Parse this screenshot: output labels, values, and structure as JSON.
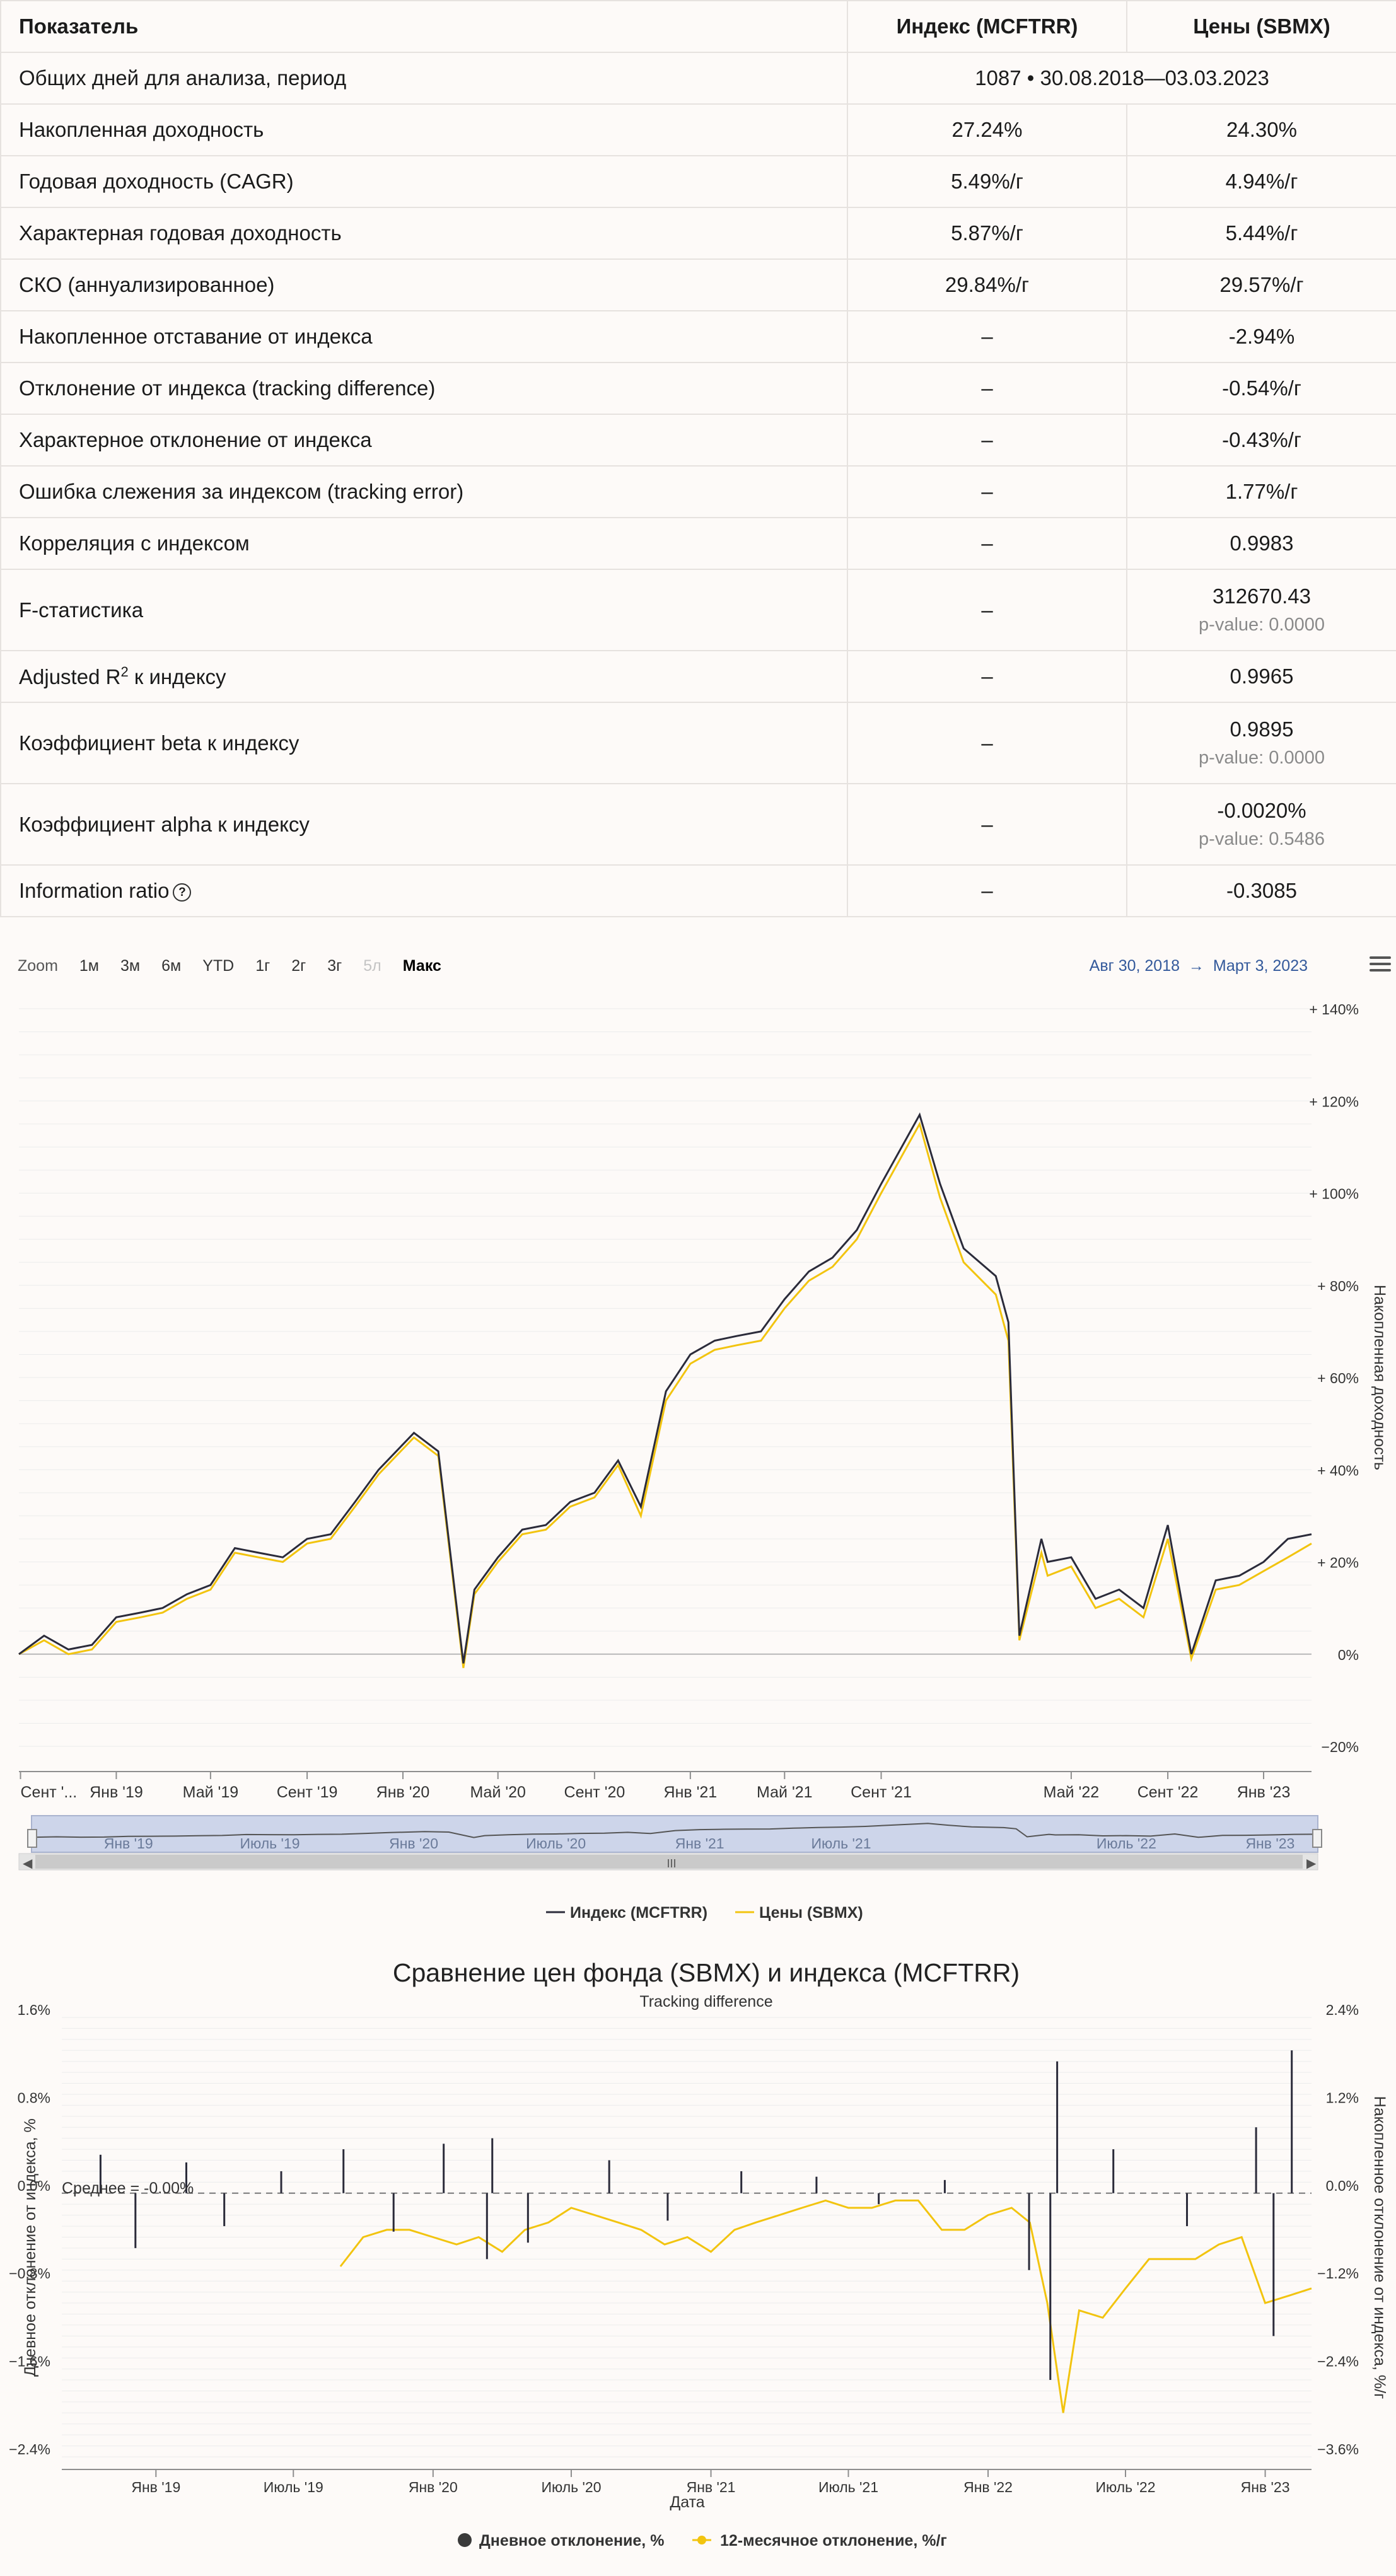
{
  "table": {
    "headers": [
      "Показатель",
      "Индекс (MCFTRR)",
      "Цены (SBMX)"
    ],
    "period_row": {
      "label": "Общих дней для анализа, период",
      "value": "1087 • 30.08.2018—03.03.2023"
    },
    "rows": [
      {
        "label": "Накопленная доходность",
        "index": "27.24%",
        "price": "24.30%"
      },
      {
        "label": "Годовая доходность (CAGR)",
        "index": "5.49%/г",
        "price": "4.94%/г"
      },
      {
        "label": "Характерная годовая доходность",
        "index": "5.87%/г",
        "price": "5.44%/г"
      },
      {
        "label": "СКО (аннуализированное)",
        "index": "29.84%/г",
        "price": "29.57%/г"
      },
      {
        "label": "Накопленное отставание от индекса",
        "index": "–",
        "price": "-2.94%"
      },
      {
        "label": "Отклонение от индекса (tracking difference)",
        "index": "–",
        "price": "-0.54%/г"
      },
      {
        "label": "Характерное отклонение от индекса",
        "index": "–",
        "price": "-0.43%/г"
      },
      {
        "label": "Ошибка слежения за индексом (tracking error)",
        "index": "–",
        "price": "1.77%/г"
      },
      {
        "label": "Корреляция с индексом",
        "index": "–",
        "price": "0.9983"
      }
    ],
    "f_stat": {
      "label": "F-статистика",
      "index": "–",
      "price": "312670.43",
      "pvalue": "p-value: 0.0000"
    },
    "adj_r2": {
      "label_prefix": "Adjusted R",
      "label_sup": "2",
      "label_suffix": " к индексу",
      "index": "–",
      "price": "0.9965"
    },
    "beta": {
      "label": "Коэффициент beta к индексу",
      "index": "–",
      "price": "0.9895",
      "pvalue": "p-value: 0.0000"
    },
    "alpha": {
      "label": "Коэффициент alpha к индексу",
      "index": "–",
      "price": "-0.0020%",
      "pvalue": "p-value: 0.5486"
    },
    "info_ratio": {
      "label": "Information ratio",
      "index": "–",
      "price": "-0.3085",
      "icon": "question-circle-icon"
    }
  },
  "chart1_toolbar": {
    "zoom_label": "Zoom",
    "buttons": [
      "1м",
      "3м",
      "6м",
      "YTD",
      "1г",
      "2г",
      "3г",
      "5л",
      "Макс"
    ],
    "active": "Макс",
    "disabled": "5л",
    "range_from": "Авг 30, 2018",
    "range_arrow": "→",
    "range_to": "Март 3, 2023",
    "menu_icon": "hamburger-menu-icon"
  },
  "chart_data": [
    {
      "type": "line",
      "ylabel": "Накопленная доходность",
      "ylim": [
        -20,
        140
      ],
      "ytick_labels": [
        "+ 140%",
        "+ 120%",
        "+ 100%",
        "+ 80%",
        "+ 60%",
        "+ 40%",
        "+ 20%",
        "0%",
        "−20%"
      ],
      "ytick_values": [
        140,
        120,
        100,
        80,
        60,
        40,
        20,
        0,
        -20
      ],
      "xtick_labels": [
        "Сент '...",
        "Янв '19",
        "Май '19",
        "Сент '19",
        "Янв '20",
        "Май '20",
        "Сент '20",
        "Янв '21",
        "Май '21",
        "Сент '21",
        "Май '22",
        "Сент '22",
        "Янв '23"
      ],
      "xtick_dates": [
        "2018-09-01",
        "2019-01-01",
        "2019-05-01",
        "2019-09-01",
        "2020-01-01",
        "2020-05-01",
        "2020-09-01",
        "2021-01-01",
        "2021-05-01",
        "2021-09-01",
        "2022-05-01",
        "2022-09-01",
        "2023-01-01"
      ],
      "xlim": [
        "2018-08-30",
        "2023-03-03"
      ],
      "grid": true,
      "legend_position": "bottom",
      "colors": {
        "index": "#2b2b3a",
        "price": "#f2c40f"
      },
      "series": [
        {
          "name": "Индекс (MCFTRR)",
          "x": [
            "2018-08-30",
            "2018-10-01",
            "2018-11-01",
            "2018-12-01",
            "2019-01-01",
            "2019-02-01",
            "2019-03-01",
            "2019-04-01",
            "2019-05-01",
            "2019-06-01",
            "2019-07-01",
            "2019-08-01",
            "2019-09-01",
            "2019-10-01",
            "2019-11-01",
            "2019-12-01",
            "2020-01-15",
            "2020-02-15",
            "2020-03-18",
            "2020-04-01",
            "2020-05-01",
            "2020-06-01",
            "2020-07-01",
            "2020-08-01",
            "2020-09-01",
            "2020-10-01",
            "2020-10-30",
            "2020-12-01",
            "2021-01-01",
            "2021-02-01",
            "2021-03-01",
            "2021-04-01",
            "2021-05-01",
            "2021-06-01",
            "2021-07-01",
            "2021-08-01",
            "2021-09-01",
            "2021-10-20",
            "2021-11-15",
            "2021-12-15",
            "2022-01-25",
            "2022-02-10",
            "2022-02-24",
            "2022-03-24",
            "2022-04-01",
            "2022-05-01",
            "2022-06-01",
            "2022-07-01",
            "2022-08-01",
            "2022-09-01",
            "2022-10-01",
            "2022-11-01",
            "2022-12-01",
            "2023-01-01",
            "2023-02-01",
            "2023-03-03"
          ],
          "values": [
            0,
            4,
            1,
            2,
            8,
            9,
            10,
            13,
            15,
            23,
            22,
            21,
            25,
            26,
            33,
            40,
            48,
            44,
            -2,
            14,
            21,
            27,
            28,
            33,
            35,
            42,
            32,
            57,
            65,
            68,
            69,
            70,
            77,
            83,
            86,
            92,
            102,
            117,
            102,
            88,
            82,
            72,
            4,
            25,
            20,
            21,
            12,
            14,
            10,
            28,
            0,
            16,
            17,
            20,
            25,
            26
          ]
        },
        {
          "name": "Цены (SBMX)",
          "x": [
            "2018-08-30",
            "2018-10-01",
            "2018-11-01",
            "2018-12-01",
            "2019-01-01",
            "2019-02-01",
            "2019-03-01",
            "2019-04-01",
            "2019-05-01",
            "2019-06-01",
            "2019-07-01",
            "2019-08-01",
            "2019-09-01",
            "2019-10-01",
            "2019-11-01",
            "2019-12-01",
            "2020-01-15",
            "2020-02-15",
            "2020-03-18",
            "2020-04-01",
            "2020-05-01",
            "2020-06-01",
            "2020-07-01",
            "2020-08-01",
            "2020-09-01",
            "2020-10-01",
            "2020-10-30",
            "2020-12-01",
            "2021-01-01",
            "2021-02-01",
            "2021-03-01",
            "2021-04-01",
            "2021-05-01",
            "2021-06-01",
            "2021-07-01",
            "2021-08-01",
            "2021-09-01",
            "2021-10-20",
            "2021-11-15",
            "2021-12-15",
            "2022-01-25",
            "2022-02-10",
            "2022-02-24",
            "2022-03-24",
            "2022-04-01",
            "2022-05-01",
            "2022-06-01",
            "2022-07-01",
            "2022-08-01",
            "2022-09-01",
            "2022-10-01",
            "2022-11-01",
            "2022-12-01",
            "2023-01-01",
            "2023-02-01",
            "2023-03-03"
          ],
          "values": [
            0,
            3,
            0,
            1,
            7,
            8,
            9,
            12,
            14,
            22,
            21,
            20,
            24,
            25,
            32,
            39,
            47,
            43,
            -3,
            13,
            20,
            26,
            27,
            32,
            34,
            41,
            30,
            55,
            63,
            66,
            67,
            68,
            75,
            81,
            84,
            90,
            100,
            115,
            99,
            85,
            78,
            68,
            3,
            22,
            17,
            19,
            10,
            12,
            8,
            25,
            -1,
            14,
            15,
            18,
            21,
            24
          ]
        }
      ]
    },
    {
      "type": "line",
      "title": "Сравнение цен фонда (SBMX) и индекса (MCFTRR)",
      "subtitle": "Tracking difference",
      "xlabel": "Дата",
      "ylabel": "Дневное отклонение от индекса, %",
      "y2label": "Накопленное отклонение от индекса, %/г",
      "ylim": [
        -2.4,
        1.6
      ],
      "y2lim": [
        -3.6,
        2.4
      ],
      "ytick_labels": [
        "1.6%",
        "0.8%",
        "0.0%",
        "−0.8%",
        "−1.6%",
        "−2.4%"
      ],
      "ytick_values": [
        1.6,
        0.8,
        0,
        -0.8,
        -1.6,
        -2.4
      ],
      "y2tick_labels": [
        "2.4%",
        "1.2%",
        "0.0%",
        "−1.2%",
        "−2.4%",
        "−3.6%"
      ],
      "y2tick_values": [
        2.4,
        1.2,
        0,
        -1.2,
        -2.4,
        -3.6
      ],
      "xtick_labels": [
        "Янв '19",
        "Июль '19",
        "Янв '20",
        "Июль '20",
        "Янв '21",
        "Июль '21",
        "Янв '22",
        "Июль '22",
        "Янв '23"
      ],
      "xtick_dates": [
        "2019-01-01",
        "2019-07-01",
        "2020-01-01",
        "2020-07-01",
        "2021-01-01",
        "2021-07-01",
        "2022-01-01",
        "2022-07-01",
        "2023-01-01"
      ],
      "xlim": [
        "2018-08-30",
        "2023-03-03"
      ],
      "mean_label": "Среднее = -0.00%",
      "legend_position": "bottom",
      "colors": {
        "daily": "#2b2b3a",
        "rolling": "#f2c40f"
      },
      "series": [
        {
          "name": "Дневное отклонение, %",
          "x": [
            "2018-10-20",
            "2018-12-05",
            "2019-02-10",
            "2019-04-01",
            "2019-06-15",
            "2019-09-05",
            "2019-11-10",
            "2020-01-15",
            "2020-03-12",
            "2020-03-19",
            "2020-05-05",
            "2020-08-20",
            "2020-11-05",
            "2021-02-10",
            "2021-05-20",
            "2021-08-10",
            "2021-11-05",
            "2022-02-24",
            "2022-03-24",
            "2022-04-02",
            "2022-06-15",
            "2022-09-20",
            "2022-12-20",
            "2023-01-12",
            "2023-02-05"
          ],
          "values": [
            0.35,
            -0.5,
            0.28,
            -0.3,
            0.2,
            0.4,
            -0.35,
            0.45,
            -0.6,
            0.5,
            -0.45,
            0.3,
            -0.25,
            0.2,
            0.15,
            -0.1,
            0.12,
            -0.7,
            -1.7,
            1.2,
            0.4,
            -0.3,
            0.6,
            -1.3,
            1.3
          ]
        },
        {
          "name": "12-месячное отклонение, %/г",
          "x": [
            "2019-09-01",
            "2019-10-01",
            "2019-11-01",
            "2019-12-01",
            "2020-01-01",
            "2020-02-01",
            "2020-03-01",
            "2020-04-01",
            "2020-05-01",
            "2020-06-01",
            "2020-07-01",
            "2020-08-01",
            "2020-09-01",
            "2020-10-01",
            "2020-11-01",
            "2020-12-01",
            "2021-01-01",
            "2021-02-01",
            "2021-03-01",
            "2021-04-01",
            "2021-05-01",
            "2021-06-01",
            "2021-07-01",
            "2021-08-01",
            "2021-09-01",
            "2021-10-01",
            "2021-11-01",
            "2021-12-01",
            "2022-01-01",
            "2022-02-01",
            "2022-02-25",
            "2022-03-20",
            "2022-04-10",
            "2022-05-01",
            "2022-06-01",
            "2022-07-01",
            "2022-08-01",
            "2022-09-01",
            "2022-10-01",
            "2022-11-01",
            "2022-12-01",
            "2023-01-01",
            "2023-02-01",
            "2023-03-03"
          ],
          "values": [
            -1.0,
            -0.6,
            -0.5,
            -0.5,
            -0.6,
            -0.7,
            -0.6,
            -0.8,
            -0.5,
            -0.4,
            -0.2,
            -0.3,
            -0.4,
            -0.5,
            -0.7,
            -0.6,
            -0.8,
            -0.5,
            -0.4,
            -0.3,
            -0.2,
            -0.1,
            -0.2,
            -0.2,
            -0.1,
            -0.1,
            -0.5,
            -0.5,
            -0.3,
            -0.2,
            -0.4,
            -1.5,
            -3.0,
            -1.6,
            -1.7,
            -1.3,
            -0.9,
            -0.9,
            -0.9,
            -0.7,
            -0.6,
            -1.5,
            -1.4,
            -1.3
          ]
        }
      ]
    }
  ],
  "navigator": {
    "xtick_labels": [
      "Янв '19",
      "Июль '19",
      "Янв '20",
      "Июль '20",
      "Янв '21",
      "Июль '21",
      "Июль '22",
      "Янв '23"
    ],
    "xtick_dates": [
      "2019-01-01",
      "2019-07-01",
      "2020-01-01",
      "2020-07-01",
      "2021-01-01",
      "2021-07-01",
      "2022-07-01",
      "2023-01-01"
    ],
    "scrollbar_grip": "III"
  }
}
